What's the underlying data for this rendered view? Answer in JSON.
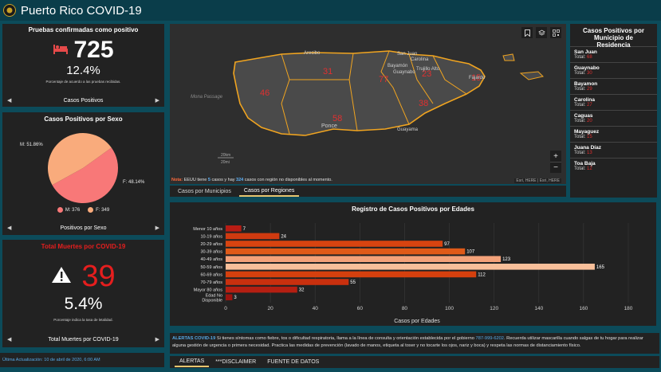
{
  "header": {
    "title": "Puerto Rico COVID-19"
  },
  "confirmed": {
    "title": "Pruebas confirmadas como positivo",
    "value": "725",
    "percent": "12.4%",
    "note": "Porcentaje de acuerdo a las pruebas recibidas.",
    "pager_label": "Casos Positivos"
  },
  "sex": {
    "title": "Casos Positivos por Sexo",
    "pager_label": "Positivos por Sexo",
    "legend_m": "M: 376",
    "legend_f": "F: 349",
    "label_m": "M: 51.86%",
    "label_f": "F: 48.14%",
    "colors": {
      "m": "#f87878",
      "f": "#f9ab7c"
    }
  },
  "deaths": {
    "title": "Total Muertes por COVID-19",
    "value": "39",
    "percent": "5.4%",
    "note": "Porcentaje indica la tasa de letalidad.",
    "pager_label": "Total Muertes por COVID-19",
    "color": "#e61e1e"
  },
  "update": {
    "text": "Última Actualización: 10 de abril de 2020, 6:00 AM"
  },
  "map": {
    "note_prefix": "Nota:",
    "note_1": "EEUU tiene",
    "note_us": "5",
    "note_2": "casos y hay",
    "note_unknown": "324",
    "note_3": "casos con región no disponibles al momento.",
    "places": [
      "Arecibo",
      "San Juan",
      "Carolina",
      "Bayamón",
      "Trujillo Alto",
      "Guaynabo",
      "Fajardo",
      "Ponce",
      "Guayama",
      "Mona Passage"
    ],
    "region_counts": [
      "31",
      "46",
      "77",
      "23",
      "15",
      "38",
      "58"
    ],
    "scale_km": "20km",
    "scale_mi": "20mi",
    "attribution": "Esri, HERE | Esri, HERE",
    "tabs": [
      "Casos por Municipios",
      "Casos por Regiones"
    ],
    "active_tab": 1,
    "icons": [
      "bookmark-icon",
      "layers-icon",
      "qr-icon"
    ],
    "zoom_in": "+",
    "zoom_out": "−"
  },
  "municipalities": {
    "title": "Casos Positivos por Municipio de Residencia",
    "total_label": "Total:",
    "items": [
      {
        "name": "San Juan",
        "total": "68"
      },
      {
        "name": "Guaynabo",
        "total": "30"
      },
      {
        "name": "Bayamon",
        "total": "29"
      },
      {
        "name": "Carolina",
        "total": "27"
      },
      {
        "name": "Caguas",
        "total": "20"
      },
      {
        "name": "Mayaguez",
        "total": "15"
      },
      {
        "name": "Juana Díaz",
        "total": "13"
      },
      {
        "name": "Toa Baja",
        "total": "12"
      }
    ]
  },
  "chart_data": {
    "type": "bar",
    "title": "Registro de Casos Positivos por Edades",
    "xlabel": "Casos por Edades",
    "ylabel": "",
    "categories": [
      "Menor 10 años",
      "10-19 años",
      "20-29 años",
      "30-39 años",
      "40-49 años",
      "50-59 años",
      "60-69 años",
      "70-79 años",
      "Mayor 80 años",
      "Edad No Disponible"
    ],
    "values": [
      7,
      24,
      97,
      107,
      123,
      165,
      112,
      55,
      32,
      3
    ],
    "colors": [
      "#b81c14",
      "#cf3a10",
      "#d84410",
      "#e05a18",
      "#f3a27a",
      "#f8bf9a",
      "#d5400e",
      "#c9300e",
      "#b51f12",
      "#9e140f"
    ],
    "xlim": [
      0,
      180
    ],
    "xticks": [
      0,
      20,
      40,
      60,
      80,
      100,
      120,
      140,
      160,
      180
    ],
    "grid": true
  },
  "alerts": {
    "title": "ALERTAS COVID-19",
    "text_1": "Si tienes síntomas como fiebre, tos o dificultad respiratoria, llama a la línea de consulta y orientación establecida por el gobierno",
    "phone": "787-999-6202",
    "text_2": ". Recuerda utilizar mascarilla cuando salgas de tu hogar para realizar alguna gestión de urgencia o primera necesidad. Practica las medidas de prevención (lavado de manos, etiqueta al toser y no tocarte los ojos, nariz y boca) y respeta las normas de distanciamiento físico.",
    "tabs": [
      "ALERTAS",
      "***DISCLAIMER",
      "FUENTE DE DATOS"
    ],
    "active_tab": 0
  }
}
